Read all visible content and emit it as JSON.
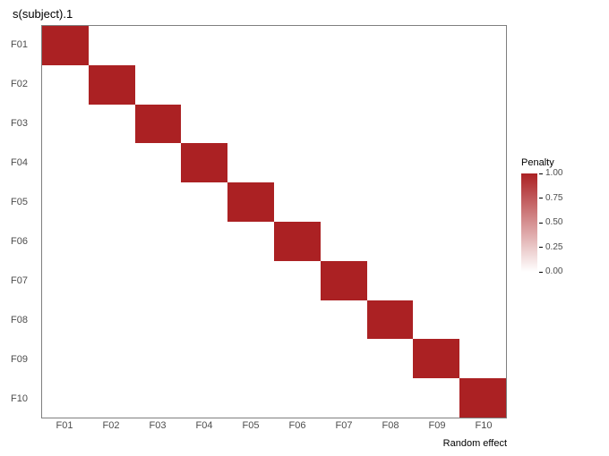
{
  "chart_data": {
    "type": "heatmap",
    "title": "s(subject).1",
    "xlabel": "Random effect",
    "ylabel": "",
    "x_categories": [
      "F01",
      "F02",
      "F03",
      "F04",
      "F05",
      "F06",
      "F07",
      "F08",
      "F09",
      "F10"
    ],
    "y_categories": [
      "F01",
      "F02",
      "F03",
      "F04",
      "F05",
      "F06",
      "F07",
      "F08",
      "F09",
      "F10"
    ],
    "matrix": [
      [
        1,
        0,
        0,
        0,
        0,
        0,
        0,
        0,
        0,
        0
      ],
      [
        0,
        1,
        0,
        0,
        0,
        0,
        0,
        0,
        0,
        0
      ],
      [
        0,
        0,
        1,
        0,
        0,
        0,
        0,
        0,
        0,
        0
      ],
      [
        0,
        0,
        0,
        1,
        0,
        0,
        0,
        0,
        0,
        0
      ],
      [
        0,
        0,
        0,
        0,
        1,
        0,
        0,
        0,
        0,
        0
      ],
      [
        0,
        0,
        0,
        0,
        0,
        1,
        0,
        0,
        0,
        0
      ],
      [
        0,
        0,
        0,
        0,
        0,
        0,
        1,
        0,
        0,
        0
      ],
      [
        0,
        0,
        0,
        0,
        0,
        0,
        0,
        1,
        0,
        0
      ],
      [
        0,
        0,
        0,
        0,
        0,
        0,
        0,
        0,
        1,
        0
      ],
      [
        0,
        0,
        0,
        0,
        0,
        0,
        0,
        0,
        0,
        1
      ]
    ],
    "legend": {
      "title": "Penalty",
      "ticks": [
        "1.00",
        "0.75",
        "0.50",
        "0.25",
        "0.00"
      ],
      "min": 0.0,
      "max": 1.0
    },
    "colors": {
      "low": "#ffffff",
      "high": "#ab2123"
    }
  }
}
